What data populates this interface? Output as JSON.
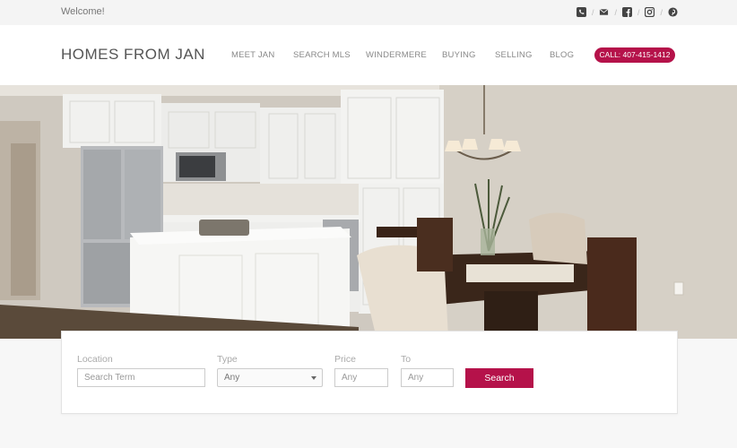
{
  "topbar": {
    "welcome": "Welcome!",
    "social_icons": [
      "phone-icon",
      "mail-icon",
      "facebook-icon",
      "instagram-icon",
      "pinterest-icon"
    ]
  },
  "header": {
    "brand": "HOMES FROM JAN",
    "nav": [
      "MEET JAN",
      "SEARCH MLS",
      "WINDERMERE",
      "BUYING",
      "SELLING",
      "BLOG"
    ],
    "cta": "CALL: 407-415-1412"
  },
  "search": {
    "location_label": "Location",
    "location_placeholder": "Search Term",
    "type_label": "Type",
    "type_value": "Any",
    "price_label": "Price",
    "price_placeholder": "Any",
    "to_label": "To",
    "to_placeholder": "Any",
    "button": "Search"
  },
  "colors": {
    "accent": "#b5124a"
  }
}
